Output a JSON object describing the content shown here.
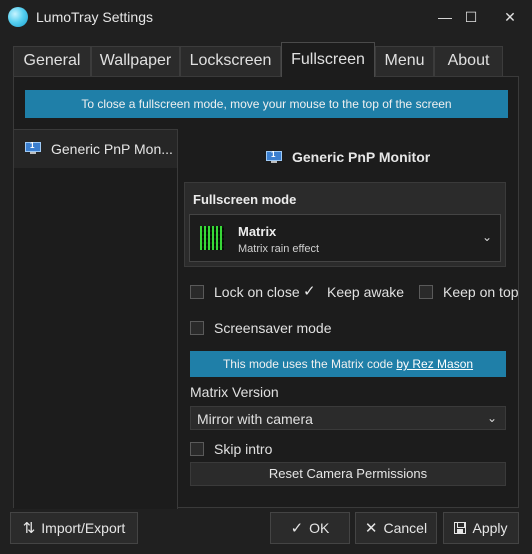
{
  "window": {
    "title": "LumoTray Settings"
  },
  "tabs": [
    {
      "label": "General"
    },
    {
      "label": "Wallpaper"
    },
    {
      "label": "Lockscreen"
    },
    {
      "label": "Fullscreen",
      "active": true
    },
    {
      "label": "Menu"
    },
    {
      "label": "About"
    }
  ],
  "banner": {
    "text": "To close a fullscreen mode, move your mouse to the top of the screen"
  },
  "monitors": [
    {
      "label": "Generic PnP Mon...",
      "index": "1",
      "icon": "monitor-icon"
    }
  ],
  "selected_monitor": {
    "name": "Generic PnP Monitor",
    "index": "1"
  },
  "fullscreen": {
    "section_title": "Fullscreen mode",
    "mode_name": "Matrix",
    "mode_desc": "Matrix rain effect"
  },
  "options": {
    "lock_on_close": {
      "label": "Lock on close",
      "checked": false
    },
    "keep_awake": {
      "label": "Keep awake",
      "checked": true
    },
    "keep_on_top": {
      "label": "Keep on top",
      "checked": false
    },
    "screensaver": {
      "label": "Screensaver mode",
      "checked": false
    },
    "skip_intro": {
      "label": "Skip intro",
      "checked": false
    }
  },
  "info": {
    "text": "This mode uses the Matrix code ",
    "link": "by Rez Mason"
  },
  "matrix_version": {
    "label": "Matrix Version",
    "value": "Mirror with camera"
  },
  "reset_button": "Reset Camera Permissions",
  "footer": {
    "import_export": "Import/Export",
    "ok": "OK",
    "cancel": "Cancel",
    "apply": "Apply"
  },
  "colors": {
    "accent_bar": "#1f7fa8",
    "background": "#1c1c1c"
  }
}
